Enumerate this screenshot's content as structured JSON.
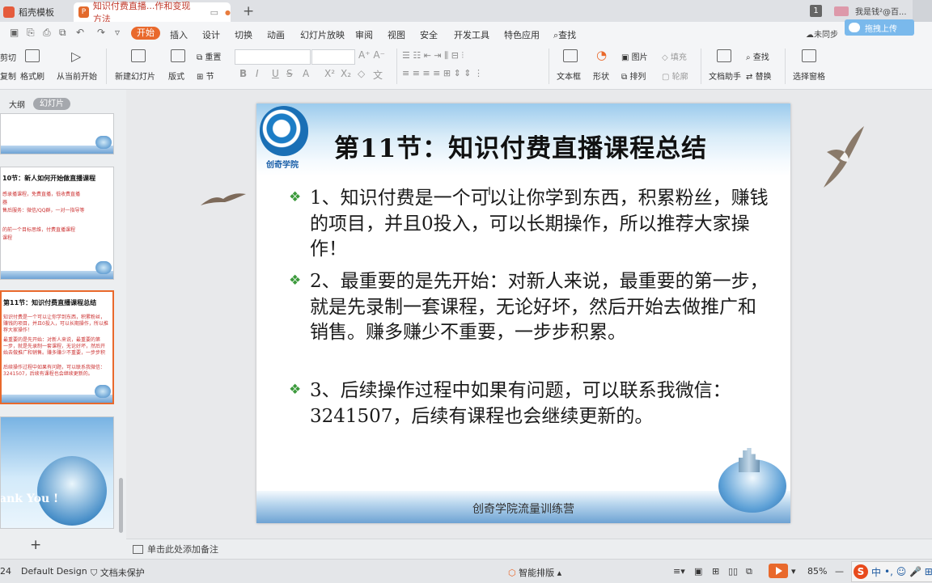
{
  "tabs": [
    {
      "label": "稻壳模板"
    },
    {
      "label": "知识付费直播...作和变现方法"
    }
  ],
  "titlebar": {
    "page_badge": "1",
    "user": "我是钱²@百..."
  },
  "menu": {
    "items": [
      "开始",
      "插入",
      "设计",
      "切换",
      "动画",
      "幻灯片放映",
      "审阅",
      "视图",
      "安全",
      "开发工具",
      "特色应用",
      "查找"
    ],
    "sync": "未同步",
    "upload": "拖拽上传"
  },
  "ribbon": {
    "cut": "剪切",
    "copy": "复制",
    "format_painter": "格式刷",
    "play_from_current": "从当前开始",
    "new_slide": "新建幻灯片",
    "layout": "版式",
    "section": "节",
    "reset": "重置",
    "textbox": "文本框",
    "shape": "形状",
    "picture": "图片",
    "fill": "填充",
    "arrange": "排列",
    "outline": "轮廓",
    "find": "查找",
    "doc_assistant": "文档助手",
    "replace": "替换",
    "select_pane": "选择窗格"
  },
  "panel": {
    "tab_outline": "大纲",
    "tab_slides": "幻灯片",
    "thumbs": [
      {
        "title": "",
        "lines": []
      },
      {
        "title": "10节：新人如何开始做直播课程",
        "lines": [
          "感录播课程，免费直播，低收费直播",
          "器",
          "售后服务：微信/QQ群，一对一指导等",
          "",
          "的前一个目标思维，付费直播课程",
          "课程"
        ]
      },
      {
        "title": "第11节：知识付费直播课程总结",
        "lines": [
          "知识付费是一个可以让你学到东西，积累粉丝，",
          "赚钱的项目，并且0投入，可以长期操作，所以推",
          "荐大家操作！",
          "最重要的是先开始：对新人来说，最重要的第",
          "一步，就是先录制一套课程，无论好坏，然后开",
          "始去做推广和销售。赚多赚少不重要，一步步积",
          "",
          "后续操作过程中如果有问题，可以联系我微信：",
          "3241507，后续有课程也会继续更新的。"
        ]
      },
      {
        "title": "ank You !",
        "lines": []
      }
    ]
  },
  "slide": {
    "logo_text": "创奇学院",
    "title": "第11节：知识付费直播课程总结",
    "bullets": [
      "1、知识付费是一个可以让你学到东西，积累粉丝，赚钱的项目，并且0投入，可以长期操作，所以推荐大家操作！",
      "2、最重要的是先开始：对新人来说，最重要的第一步，就是先录制一套课程，无论好坏，然后开始去做推广和销售。赚多赚少不重要，一步步积累。",
      "3、后续操作过程中如果有问题，可以联系我微信：3241507，后续有课程也会继续更新的。"
    ],
    "bullet_marker": "❖",
    "footer": "创奇学院流量训练营"
  },
  "notes": {
    "placeholder": "单击此处添加备注"
  },
  "status": {
    "slide_no": "24",
    "design": "Default Design",
    "protect": "文档未保护",
    "smart_layout": "智能排版",
    "zoom": "85%",
    "ime": "中"
  },
  "colors": {
    "accent": "#e9692c",
    "bullet_green": "#3c9a3c",
    "title_blue": "#1a5fa8"
  }
}
